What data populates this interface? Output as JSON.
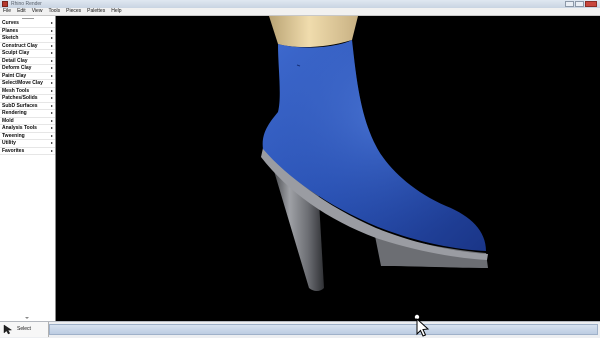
{
  "window": {
    "title": "Rhino Render"
  },
  "menu": [
    {
      "label": "File"
    },
    {
      "label": "Edit"
    },
    {
      "label": "View"
    },
    {
      "label": "Tools"
    },
    {
      "label": "Pieces"
    },
    {
      "label": "Palettes"
    },
    {
      "label": "Help"
    }
  ],
  "palette": {
    "items": [
      {
        "label": "Curves"
      },
      {
        "label": "Planes"
      },
      {
        "label": "Sketch"
      },
      {
        "label": "Construct Clay"
      },
      {
        "label": "Sculpt Clay"
      },
      {
        "label": "Detail Clay"
      },
      {
        "label": "Deform Clay"
      },
      {
        "label": "Paint Clay"
      },
      {
        "label": "Select/Move Clay"
      },
      {
        "label": "Mesh Tools"
      },
      {
        "label": "Patches/Solids"
      },
      {
        "label": "SubD Surfaces"
      },
      {
        "label": "Rendering"
      },
      {
        "label": "Mold"
      },
      {
        "label": "Analysis Tools"
      },
      {
        "label": "Tweening"
      },
      {
        "label": "Utility"
      },
      {
        "label": "Favorites"
      }
    ]
  },
  "status": {
    "tool_label": "Select"
  },
  "colors": {
    "boot_blue": "#2a52b4",
    "heel_gray": "#7d7f85",
    "leg_skin": "#e7cf9f",
    "viewport_bg": "#000000"
  },
  "icons": {
    "tool": "select-arrow-icon",
    "cursor": "mouse-pointer-icon"
  }
}
